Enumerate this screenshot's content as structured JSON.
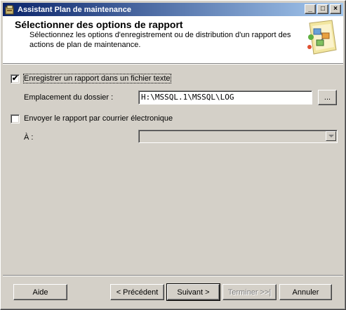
{
  "window": {
    "title": "Assistant Plan de maintenance",
    "minimize_glyph": "_",
    "maximize_glyph": "□",
    "close_glyph": "×"
  },
  "header": {
    "title": "Sélectionner des options de rapport",
    "description": "Sélectionnez les options d'enregistrement ou de distribution d'un rapport des actions de plan de maintenance."
  },
  "options": {
    "save_to_file": {
      "label": "Enregistrer un rapport dans un fichier texte",
      "checked": true,
      "check_glyph": "✔"
    },
    "folder_label": "Emplacement du dossier :",
    "folder_value": "H:\\MSSQL.1\\MSSQL\\LOG",
    "browse_label": "...",
    "send_email": {
      "label": "Envoyer le rapport par courrier électronique",
      "checked": false
    },
    "to_label": "À :",
    "to_value": ""
  },
  "footer": {
    "help": "Aide",
    "back": "< Précédent",
    "next": "Suivant >",
    "finish": "Terminer >>|",
    "cancel": "Annuler"
  }
}
